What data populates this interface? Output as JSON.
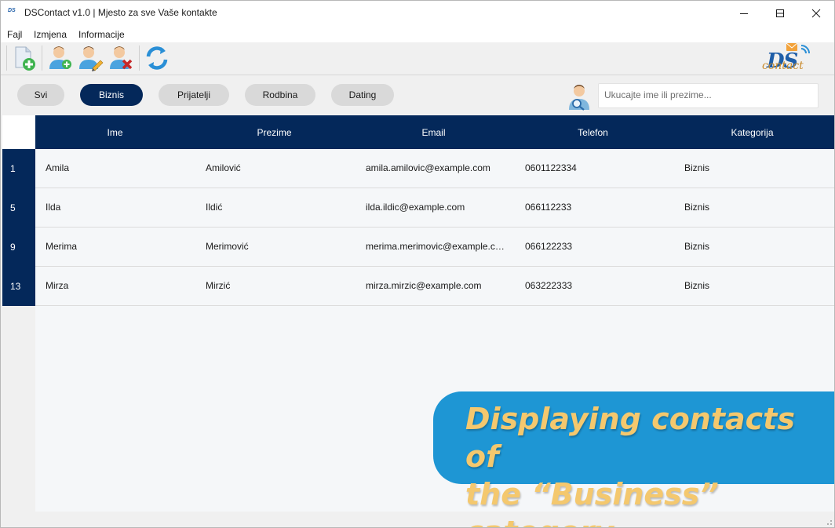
{
  "window": {
    "title": "DSContact v1.0 | Mjesto za sve Vaše kontakte",
    "app_icon_text": "DS"
  },
  "menu": {
    "items": [
      "Fajl",
      "Izmjena",
      "Informacije"
    ]
  },
  "toolbar": {
    "buttons": [
      "new-document-icon",
      "add-contact-icon",
      "edit-contact-icon",
      "delete-contact-icon",
      "refresh-icon"
    ]
  },
  "logo": {
    "text_main": "DS",
    "text_script": "contact"
  },
  "categories": {
    "tabs": [
      "Svi",
      "Biznis",
      "Prijatelji",
      "Rodbina",
      "Dating"
    ],
    "selected": "Biznis"
  },
  "search": {
    "placeholder": "Ukucajte ime ili prezime...",
    "value": ""
  },
  "table": {
    "columns": [
      "Ime",
      "Prezime",
      "Email",
      "Telefon",
      "Kategorija"
    ],
    "rows": [
      {
        "id": "1",
        "ime": "Amila",
        "prezime": "Amilović",
        "email": "amila.amilovic@example.com",
        "telefon": "0601122334",
        "kategorija": "Biznis"
      },
      {
        "id": "5",
        "ime": "Ilda",
        "prezime": "Ildić",
        "email": "ilda.ildic@example.com",
        "telefon": "066112233",
        "kategorija": "Biznis"
      },
      {
        "id": "9",
        "ime": "Merima",
        "prezime": "Merimović",
        "email": "merima.merimovic@example.com",
        "telefon": "066122233",
        "kategorija": "Biznis"
      },
      {
        "id": "13",
        "ime": "Mirza",
        "prezime": "Mirzić",
        "email": "mirza.mirzic@example.com",
        "telefon": "063222333",
        "kategorija": "Biznis"
      }
    ]
  },
  "callout": {
    "line1": "Displaying contacts of",
    "line2": "the “Business” category"
  },
  "colors": {
    "accent": "#04285a",
    "callout_bg": "#1e96d4",
    "callout_text": "#f4c86e"
  }
}
